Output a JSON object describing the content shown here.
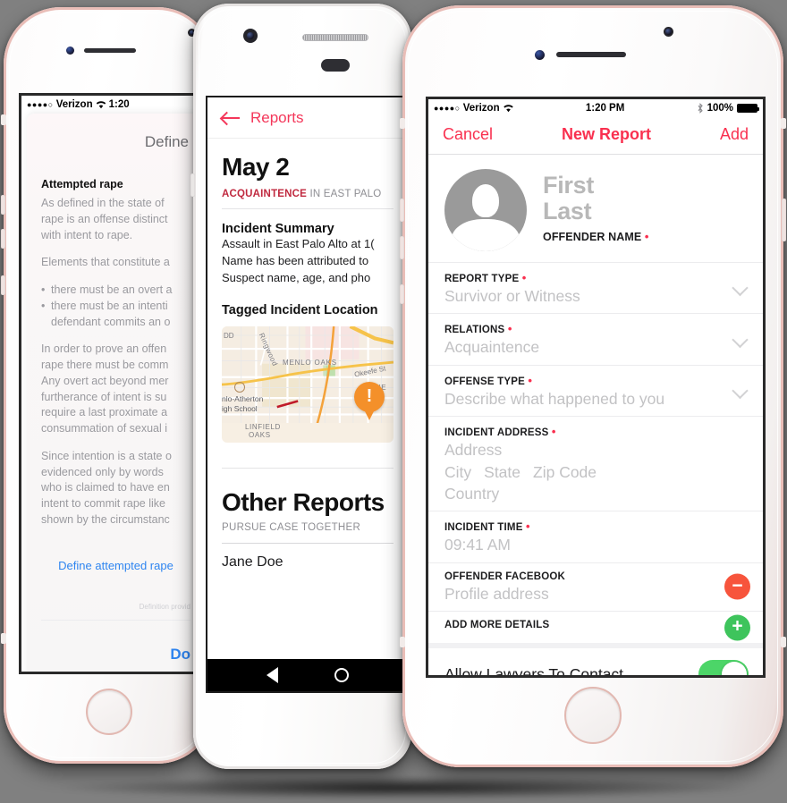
{
  "accent": {
    "ios_red": "#f9304f",
    "android_red": "#f4375a",
    "link_blue": "#2f85f0",
    "green": "#3ec45c",
    "red_minus": "#f7543c",
    "orange_pin": "#f4902a"
  },
  "phone_left": {
    "status": {
      "carrier": "Verizon",
      "dots": "●●●●○",
      "time": "1:20"
    },
    "sheet_title": "Define",
    "heading": "Attempted rape",
    "paragraphs": [
      "As defined in the state of\nrape is an offense distinct\nwith intent to rape.",
      "Elements that constitute a"
    ],
    "bullets": [
      "there must be an overt a",
      "there must be an intenti\ndefendant commits an o"
    ],
    "paragraphs2": [
      "In order to prove an offen\nrape there must be comm\nAny overt act beyond mer\nfurtherance of intent is su\nrequire a last proximate a\nconsummation of sexual i",
      "Since intention is a state o\nevidenced only by words\nwho is claimed to have en\nintent to commit rape like\nshown by the circumstanc"
    ],
    "define_link": "Define attempted rape",
    "credit": "Definition provid",
    "done_button": "Do"
  },
  "phone_middle": {
    "nav": {
      "back_icon": "arrow-left-icon",
      "title": "Reports"
    },
    "date": "May 2",
    "subtitle_highlight": "ACQUAINTENCE",
    "subtitle_rest": " IN EAST PALO",
    "summary_heading": "Incident Summary",
    "summary_lines": [
      "Assault in East Palo Alto at 1(",
      "Name has been attributed to",
      "Suspect name, age, and pho"
    ],
    "location_heading": "Tagged Incident Location",
    "map": {
      "labels": [
        "DD",
        "Ringwood",
        "MENLO OAKS",
        "Okeefe St",
        "THE W",
        "nlo-Atherton",
        "igh School",
        "LINFIELD",
        "OAKS"
      ],
      "pin_icon": "exclamation-pin-icon"
    },
    "other_heading": "Other Reports",
    "other_caption": "PURSUE CASE TOGETHER",
    "other_rows": [
      "Jane Doe"
    ],
    "navbar": {
      "back_icon": "android-back-icon",
      "home_icon": "android-home-icon"
    }
  },
  "phone_right": {
    "status": {
      "carrier": "Verizon",
      "dots": "●●●●○",
      "time": "1:20 PM",
      "bluetooth_icon": "bluetooth-icon",
      "battery": "100%"
    },
    "nav": {
      "cancel": "Cancel",
      "title": "New Report",
      "add": "Add"
    },
    "hero": {
      "avatar_icon": "person-avatar-icon",
      "first": "First",
      "last": "Last",
      "label": "OFFENDER NAME",
      "required": true
    },
    "fields": [
      {
        "label": "REPORT TYPE",
        "required": true,
        "value": "Survivor or Witness",
        "control": "chevron-down-icon"
      },
      {
        "label": "RELATIONS",
        "required": true,
        "value": "Acquaintence",
        "control": "chevron-down-icon"
      },
      {
        "label": "OFFENSE TYPE",
        "required": true,
        "value": "Describe what happened to you",
        "control": "chevron-down-icon"
      },
      {
        "label": "INCIDENT ADDRESS",
        "required": true,
        "value": "Address",
        "value_row": [
          "City",
          "State",
          "Zip Code"
        ],
        "value3": "Country",
        "control": "none"
      },
      {
        "label": "INCIDENT TIME",
        "required": true,
        "value": "09:41 AM",
        "control": "none"
      },
      {
        "label": "OFFENDER FACEBOOK",
        "required": false,
        "value": "Profile address",
        "control": "minus-button"
      },
      {
        "label": "ADD MORE DETAILS",
        "required": false,
        "value": "",
        "control": "plus-button"
      }
    ],
    "toggle": {
      "label": "Allow Lawyers To Contact",
      "on": true
    }
  }
}
